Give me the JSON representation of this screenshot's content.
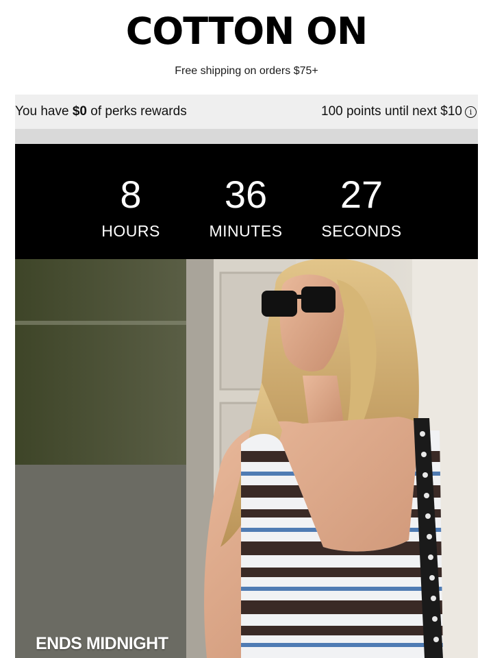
{
  "header": {
    "brand": "COTTON ON",
    "shipping_text": "Free shipping on orders $75+"
  },
  "perks": {
    "prefix": "You have ",
    "amount": "$0",
    "suffix": " of perks rewards",
    "points_text": "100 points until next $10",
    "info_icon": "info-circle-icon"
  },
  "countdown": {
    "hours_value": "8",
    "hours_label": "HOURS",
    "minutes_value": "36",
    "minutes_label": "MINUTES",
    "seconds_value": "27",
    "seconds_label": "SECONDS"
  },
  "hero": {
    "caption": "ENDS MIDNIGHT"
  },
  "colors": {
    "countdown_bg": "#000000",
    "perks_bg": "#efefef",
    "gap_bg": "#d9d9d9"
  }
}
